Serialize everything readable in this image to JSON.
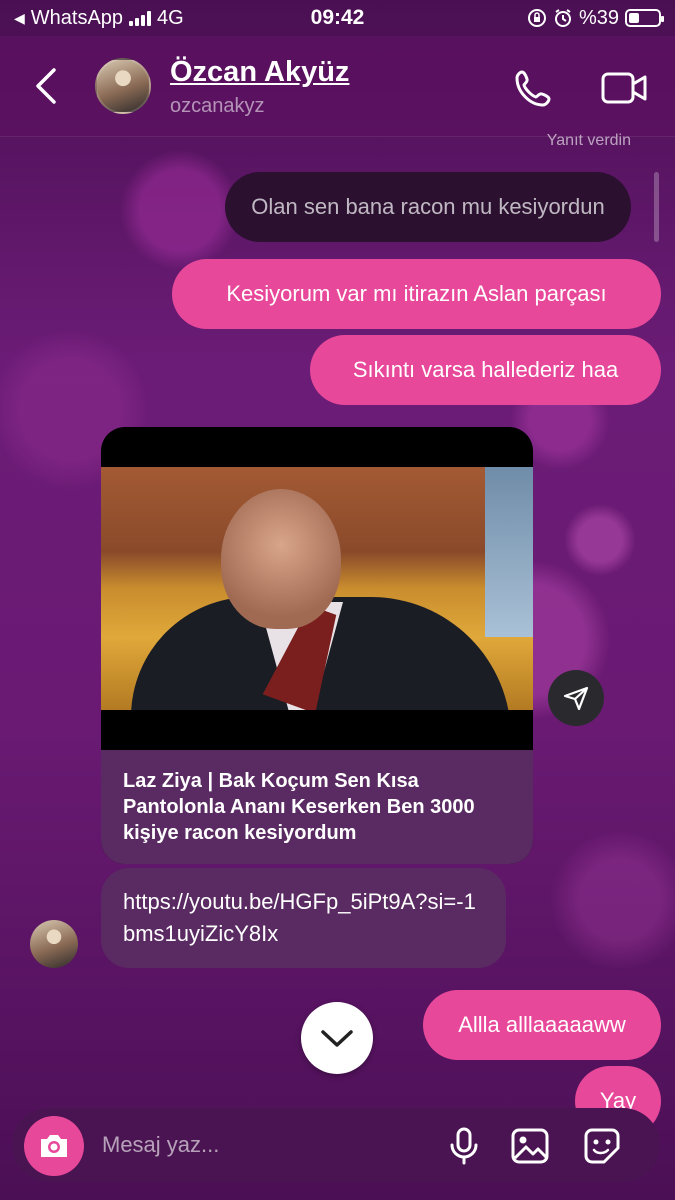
{
  "status_bar": {
    "back_app": "WhatsApp",
    "network": "4G",
    "time": "09:42",
    "battery": "%39"
  },
  "header": {
    "name": "Özcan Akyüz",
    "username": "ozcanakyz"
  },
  "chat": {
    "replied_label": "Yanıt verdin",
    "reply_quote": "Olan sen bana racon mu kesiyordun",
    "msg1": "Kesiyorum var mı itirazın Aslan parçası",
    "msg2": "Sıkıntı varsa hallederiz haa",
    "link_card_title": "Laz Ziya | Bak Koçum Sen Kısa Pantolonla Ananı Keserken Ben 3000 kişiye racon kesiyordum",
    "link_url": "https://youtu.be/HGFp_5iPt9A?si=-1bms1uyiZicY8Ix",
    "msg3": "Allla alllaaaaaww",
    "msg4": "Yay"
  },
  "composer": {
    "placeholder": "Mesaj yaz..."
  },
  "icons": {
    "back": "chevron-left-icon",
    "call": "phone-icon",
    "video": "video-camera-icon",
    "share": "send-icon",
    "scroll_down": "chevron-down-icon",
    "camera": "camera-icon",
    "mic": "microphone-icon",
    "gallery": "image-icon",
    "sticker": "sticker-icon"
  },
  "colors": {
    "accent": "#e8489a",
    "incoming_bubble": "#5a2a62",
    "header_bg": "#5a1260"
  }
}
